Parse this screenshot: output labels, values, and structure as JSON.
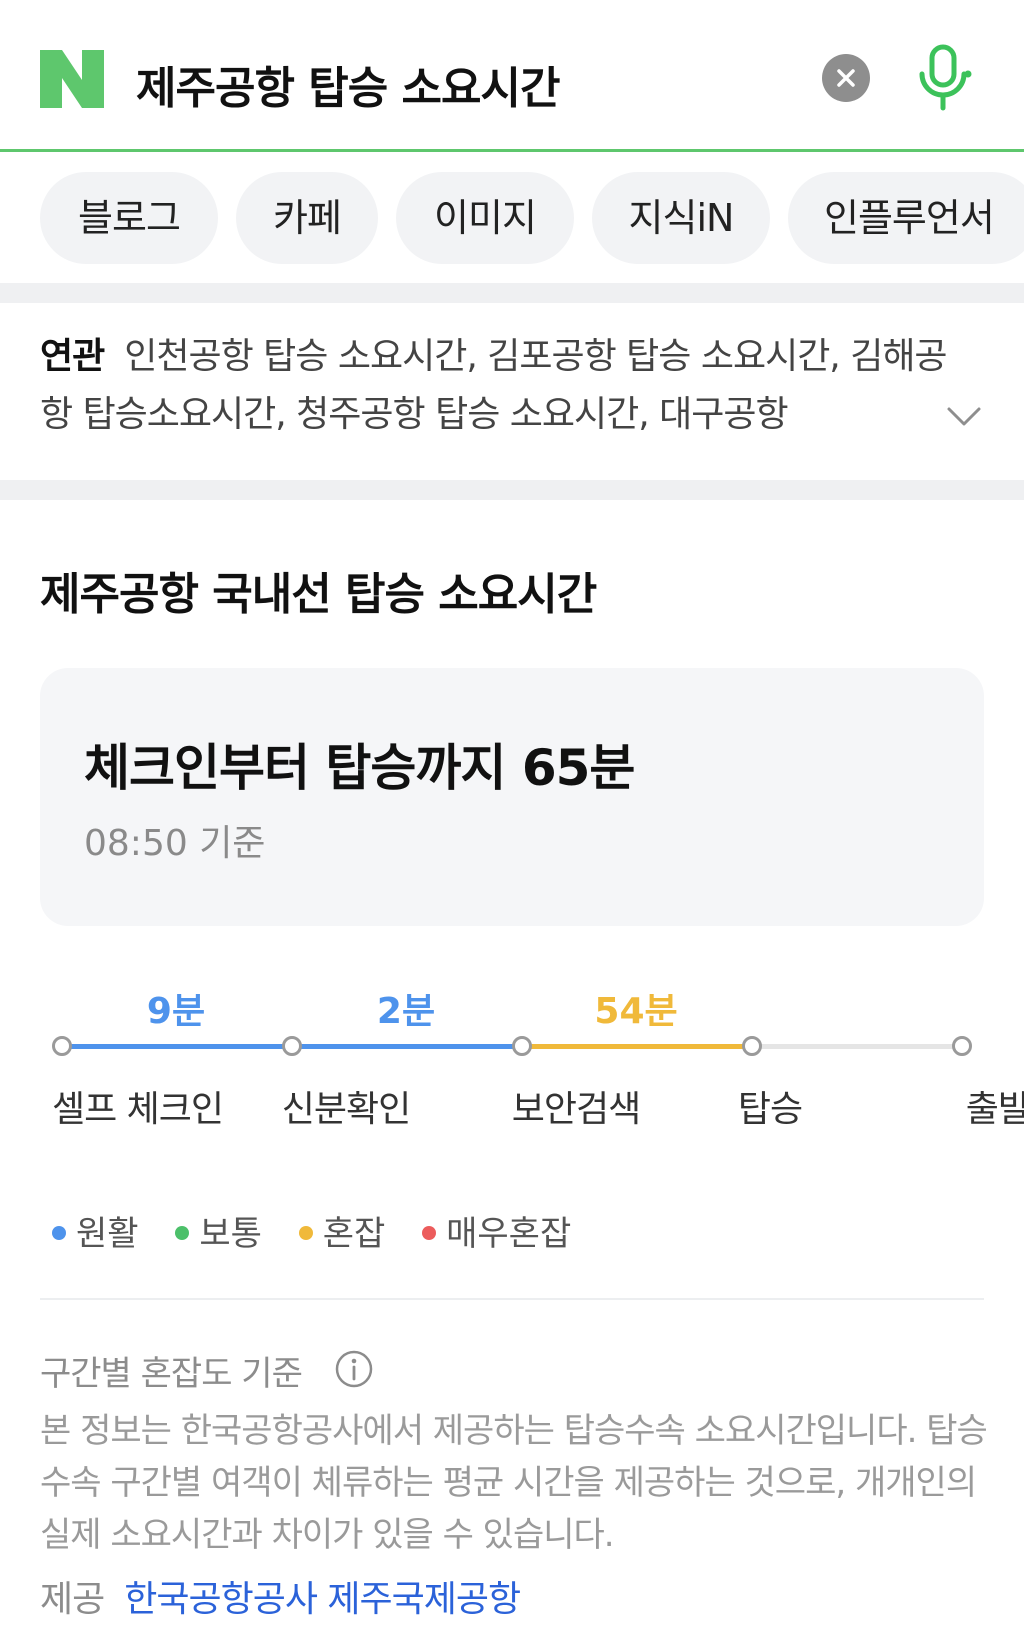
{
  "search": {
    "query": "제주공항 탑승 소요시간",
    "clear_icon": "close-icon",
    "mic_icon": "microphone-icon",
    "brand_color": "#03c75a"
  },
  "tabs": [
    "블로그",
    "카페",
    "이미지",
    "지식iN",
    "인플루언서"
  ],
  "related": {
    "label": "연관",
    "text": "인천공항 탑승 소요시간, 김포공항 탑승 소요시간, 김해공항 탑승소요시간, 청주공항 탑승 소요시간, 대구공항"
  },
  "main": {
    "title": "제주공항 국내선 탑승 소요시간",
    "summary": {
      "title": "체크인부터 탑승까지 65분",
      "subtitle": "08:50 기준"
    },
    "segments": [
      {
        "label": "9분",
        "color": "#4e93ec"
      },
      {
        "label": "2분",
        "color": "#4e93ec"
      },
      {
        "label": "54분",
        "color": "#f0b93a"
      },
      {
        "label": "",
        "color": "#e5e5e5"
      }
    ],
    "stages": [
      "셀프 체크인",
      "신분확인",
      "보안검색",
      "탑승",
      "출발"
    ],
    "legend": [
      {
        "label": "원활",
        "color": "#4e93ec"
      },
      {
        "label": "보통",
        "color": "#4cc06a"
      },
      {
        "label": "혼잡",
        "color": "#f0b93a"
      },
      {
        "label": "매우혼잡",
        "color": "#ec5c5c"
      }
    ],
    "basis": {
      "label": "구간별 혼잡도 기준",
      "icon": "info-icon",
      "description": "본 정보는 한국공항공사에서 제공하는 탑승수속 소요시간입니다. 탑승수속 구간별 여객이 체류하는 평균 시간을 제공하는 것으로, 개개인의 실제 소요시간과 차이가 있을 수 있습니다."
    },
    "provider": {
      "label": "제공",
      "value": "한국공항공사 제주국제공항"
    }
  }
}
